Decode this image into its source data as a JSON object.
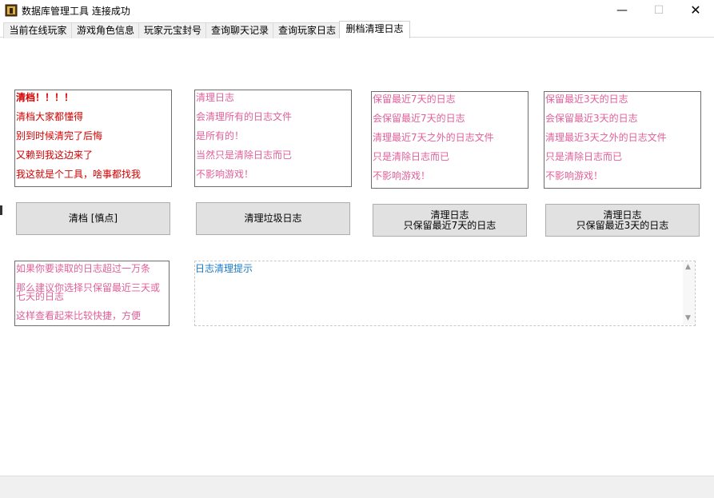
{
  "window": {
    "title": "数据库管理工具    连接成功",
    "controls": {
      "minimize": "—",
      "maximize": "☐",
      "close": "✕"
    }
  },
  "tabs": [
    {
      "label": "当前在线玩家"
    },
    {
      "label": "游戏角色信息"
    },
    {
      "label": "玩家元宝封号"
    },
    {
      "label": "查询聊天记录"
    },
    {
      "label": "查询玩家日志"
    },
    {
      "label": "删档清理日志",
      "active": true
    }
  ],
  "box1": {
    "lines": [
      "清档！！！！",
      "清档大家都懂得",
      "别到时候清完了后悔",
      "又赖到我这边来了",
      "我这就是个工具，啥事都找我"
    ]
  },
  "box2": {
    "lines": [
      "清理日志",
      "会清理所有的日志文件",
      "是所有的！",
      "当然只是清除日志而已",
      "不影响游戏！"
    ]
  },
  "box3": {
    "lines": [
      "保留最近7天的日志",
      "会保留最近7天的日志",
      "清理最近7天之外的日志文件",
      "只是清除日志而已",
      "不影响游戏！"
    ]
  },
  "box4": {
    "lines": [
      "保留最近3天的日志",
      "会保留最近3天的日志",
      "清理最近3天之外的日志文件",
      "只是清除日志而已",
      "不影响游戏！"
    ]
  },
  "buttons": {
    "wipe": "清档 [慎点]",
    "clear_junk": "清理垃圾日志",
    "keep7": {
      "line1": "清理日志",
      "line2": "只保留最近7天的日志"
    },
    "keep3": {
      "line1": "清理日志",
      "line2": "只保留最近3天的日志"
    }
  },
  "advice": {
    "lines": [
      "如果你要读取的日志超过一万条",
      "那么建议你选择只保留最近三天或",
      "七天的日志",
      "这样查看起来比较快捷，方便"
    ]
  },
  "hint": {
    "text": "日志清理提示",
    "scroll_up": "▲",
    "scroll_down": "▼"
  },
  "colors": {
    "red_text": "#d40000",
    "pink_text": "#e0609a",
    "hint_text": "#1a7bc9"
  }
}
